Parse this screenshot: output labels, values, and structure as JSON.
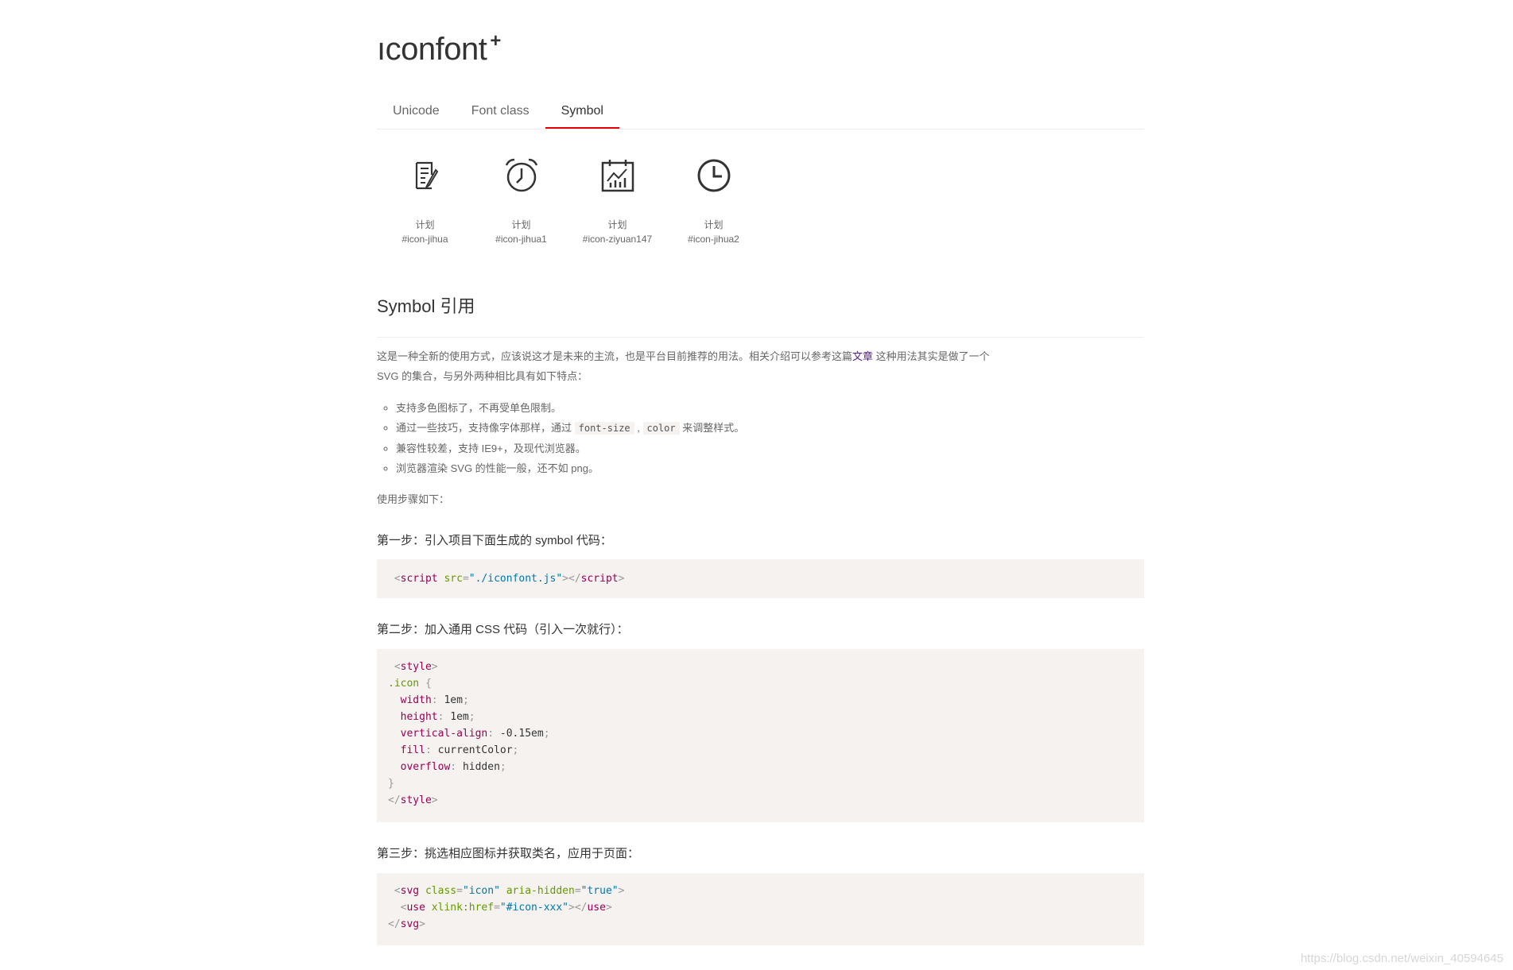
{
  "logo": {
    "text": "ıconfont",
    "plus": "+"
  },
  "tabs": [
    {
      "label": "Unicode"
    },
    {
      "label": "Font class"
    },
    {
      "label": "Symbol"
    }
  ],
  "icons": [
    {
      "name": "计划",
      "code": "#icon-jihua",
      "icon": "notepad-icon"
    },
    {
      "name": "计划",
      "code": "#icon-jihua1",
      "icon": "alarm-clock-icon"
    },
    {
      "name": "计划",
      "code": "#icon-ziyuan147",
      "icon": "calendar-chart-icon"
    },
    {
      "name": "计划",
      "code": "#icon-jihua2",
      "icon": "clock-icon"
    }
  ],
  "section": {
    "title": "Symbol 引用"
  },
  "intro": {
    "part1": "这是一种全新的使用方式，应该说这才是未来的主流，也是平台目前推荐的用法。相关介绍可以参考这篇",
    "link": "文章",
    "part2": " 这种用法其实是做了一个 SVG 的集合，与另外两种相比具有如下特点："
  },
  "features": {
    "f1": "支持多色图标了，不再受单色限制。",
    "f2_pre": "通过一些技巧，支持像字体那样，通过 ",
    "f2_code1": "font-size",
    "f2_sep": " , ",
    "f2_code2": "color",
    "f2_post": " 来调整样式。",
    "f3": "兼容性较差，支持 IE9+，及现代浏览器。",
    "f4": "浏览器渲染 SVG 的性能一般，还不如 png。"
  },
  "steps": {
    "intro": "使用步骤如下：",
    "step1": "第一步：引入项目下面生成的 symbol 代码：",
    "step2": "第二步：加入通用 CSS 代码（引入一次就行）：",
    "step3": "第三步：挑选相应图标并获取类名，应用于页面："
  },
  "code1": {
    "lt": "<",
    "tag": "script",
    "attr": "src",
    "eq": "=",
    "val": "\"./iconfont.js\"",
    "mid": "></",
    "tag2": "script",
    "gt": ">"
  },
  "code2": {
    "open_lt": "<",
    "open_tag": "style",
    "open_gt": ">",
    "selector": ".icon",
    "brace_open": " {",
    "p1": "width",
    "v1": "1em",
    "p2": "height",
    "v2": "1em",
    "p3": "vertical-align",
    "v3": "-0.15em",
    "p4": "fill",
    "v4": "currentColor",
    "p5": "overflow",
    "v5": "hidden",
    "brace_close": "}",
    "close_lt": "</",
    "close_tag": "style",
    "close_gt": ">"
  },
  "code3": {
    "svg_tag": "svg",
    "class_attr": "class",
    "class_val": "\"icon\"",
    "aria_attr": "aria-hidden",
    "aria_val": "\"true\"",
    "use_tag": "use",
    "href_attr": "xlink:href",
    "href_val": "\"#icon-xxx\"",
    "svg_close": "svg"
  },
  "watermark": "https://blog.csdn.net/weixin_40594645"
}
